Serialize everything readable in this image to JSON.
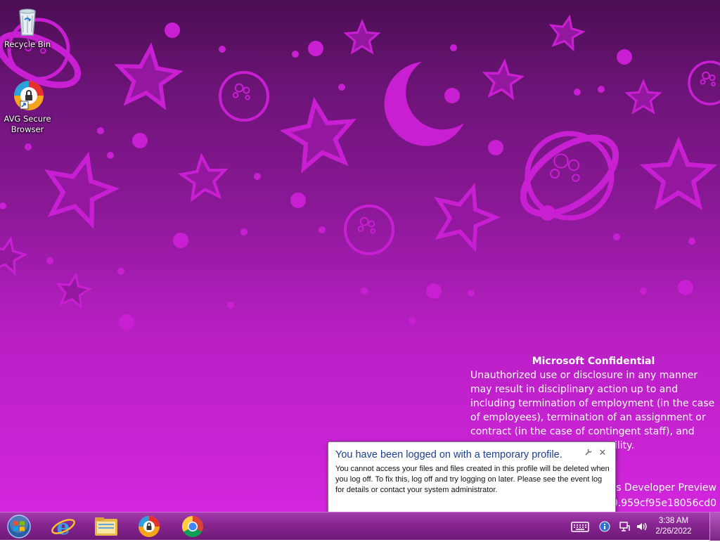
{
  "desktop_icons": [
    {
      "label": "Recycle Bin",
      "icon": "recycle-bin-icon"
    },
    {
      "label": "AVG Secure Browser",
      "icon": "avg-browser-icon"
    }
  ],
  "confidential": {
    "title": "Microsoft Confidential",
    "body": "Unauthorized use or disclosure in any manner may result in disciplinary action up to and including termination of employment (in the case of employees), termination of an assignment or contract (in the case of contingent staff), and",
    "body_end": "ility."
  },
  "watermark": {
    "line1": "ws Developer Preview",
    "line2": "00.959cf95e18056cd0"
  },
  "balloon": {
    "title": "You have been logged on with a temporary profile.",
    "body": "You cannot access your files and files created in this profile will be deleted when you log off. To fix this, log off and try logging on later. Please see the event log for details or contact your system administrator.",
    "settings_icon": "wrench-icon",
    "close_glyph": "✕"
  },
  "taskbar": {
    "pinned": [
      "start-orb",
      "internet-explorer",
      "file-explorer",
      "avg-secure-browser",
      "google-chrome"
    ],
    "tray": [
      "keyboard-icon",
      "info-icon",
      "network-icon",
      "volume-icon"
    ],
    "time": "3:38 AM",
    "date": "2/26/2022"
  },
  "colors": {
    "wallpaper_top": "#4a0e52",
    "wallpaper_bottom": "#d226dc",
    "art": "#c81fd2",
    "balloon_title": "#1e3f8f"
  }
}
